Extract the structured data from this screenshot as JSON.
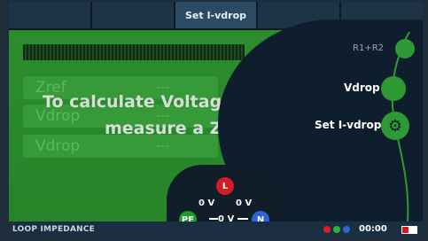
{
  "tabs": [
    {
      "label": ""
    },
    {
      "label": ""
    },
    {
      "label": "Set I-vdrop"
    },
    {
      "label": ""
    },
    {
      "label": ""
    }
  ],
  "readings": {
    "rows": [
      {
        "label": "Zref",
        "value": "---"
      },
      {
        "label": "Vdrop",
        "value": "---"
      },
      {
        "label": "Vdrop",
        "value": "---"
      }
    ]
  },
  "message": {
    "line1": "To calculate Voltage",
    "line2": "measure a Zre"
  },
  "options": {
    "r1r2": "R1+R2",
    "vdrop": "Vdrop",
    "set_ivdrop": "Set I-vdrop"
  },
  "connections": {
    "l": "L",
    "pe": "PE",
    "n": "N",
    "v_l_pe": "0 V",
    "v_l_n": "0 V",
    "v_pe_n": "0 V"
  },
  "status": {
    "mode": "LOOP IMPEDANCE",
    "time": "00:00",
    "leds": [
      "#e11d2a",
      "#2fae3a",
      "#2f63d6"
    ]
  },
  "colors": {
    "accent_green": "#2f9a33",
    "node_l": "#d11c24",
    "node_pe": "#1f9a2e",
    "node_n": "#2c64d6"
  }
}
